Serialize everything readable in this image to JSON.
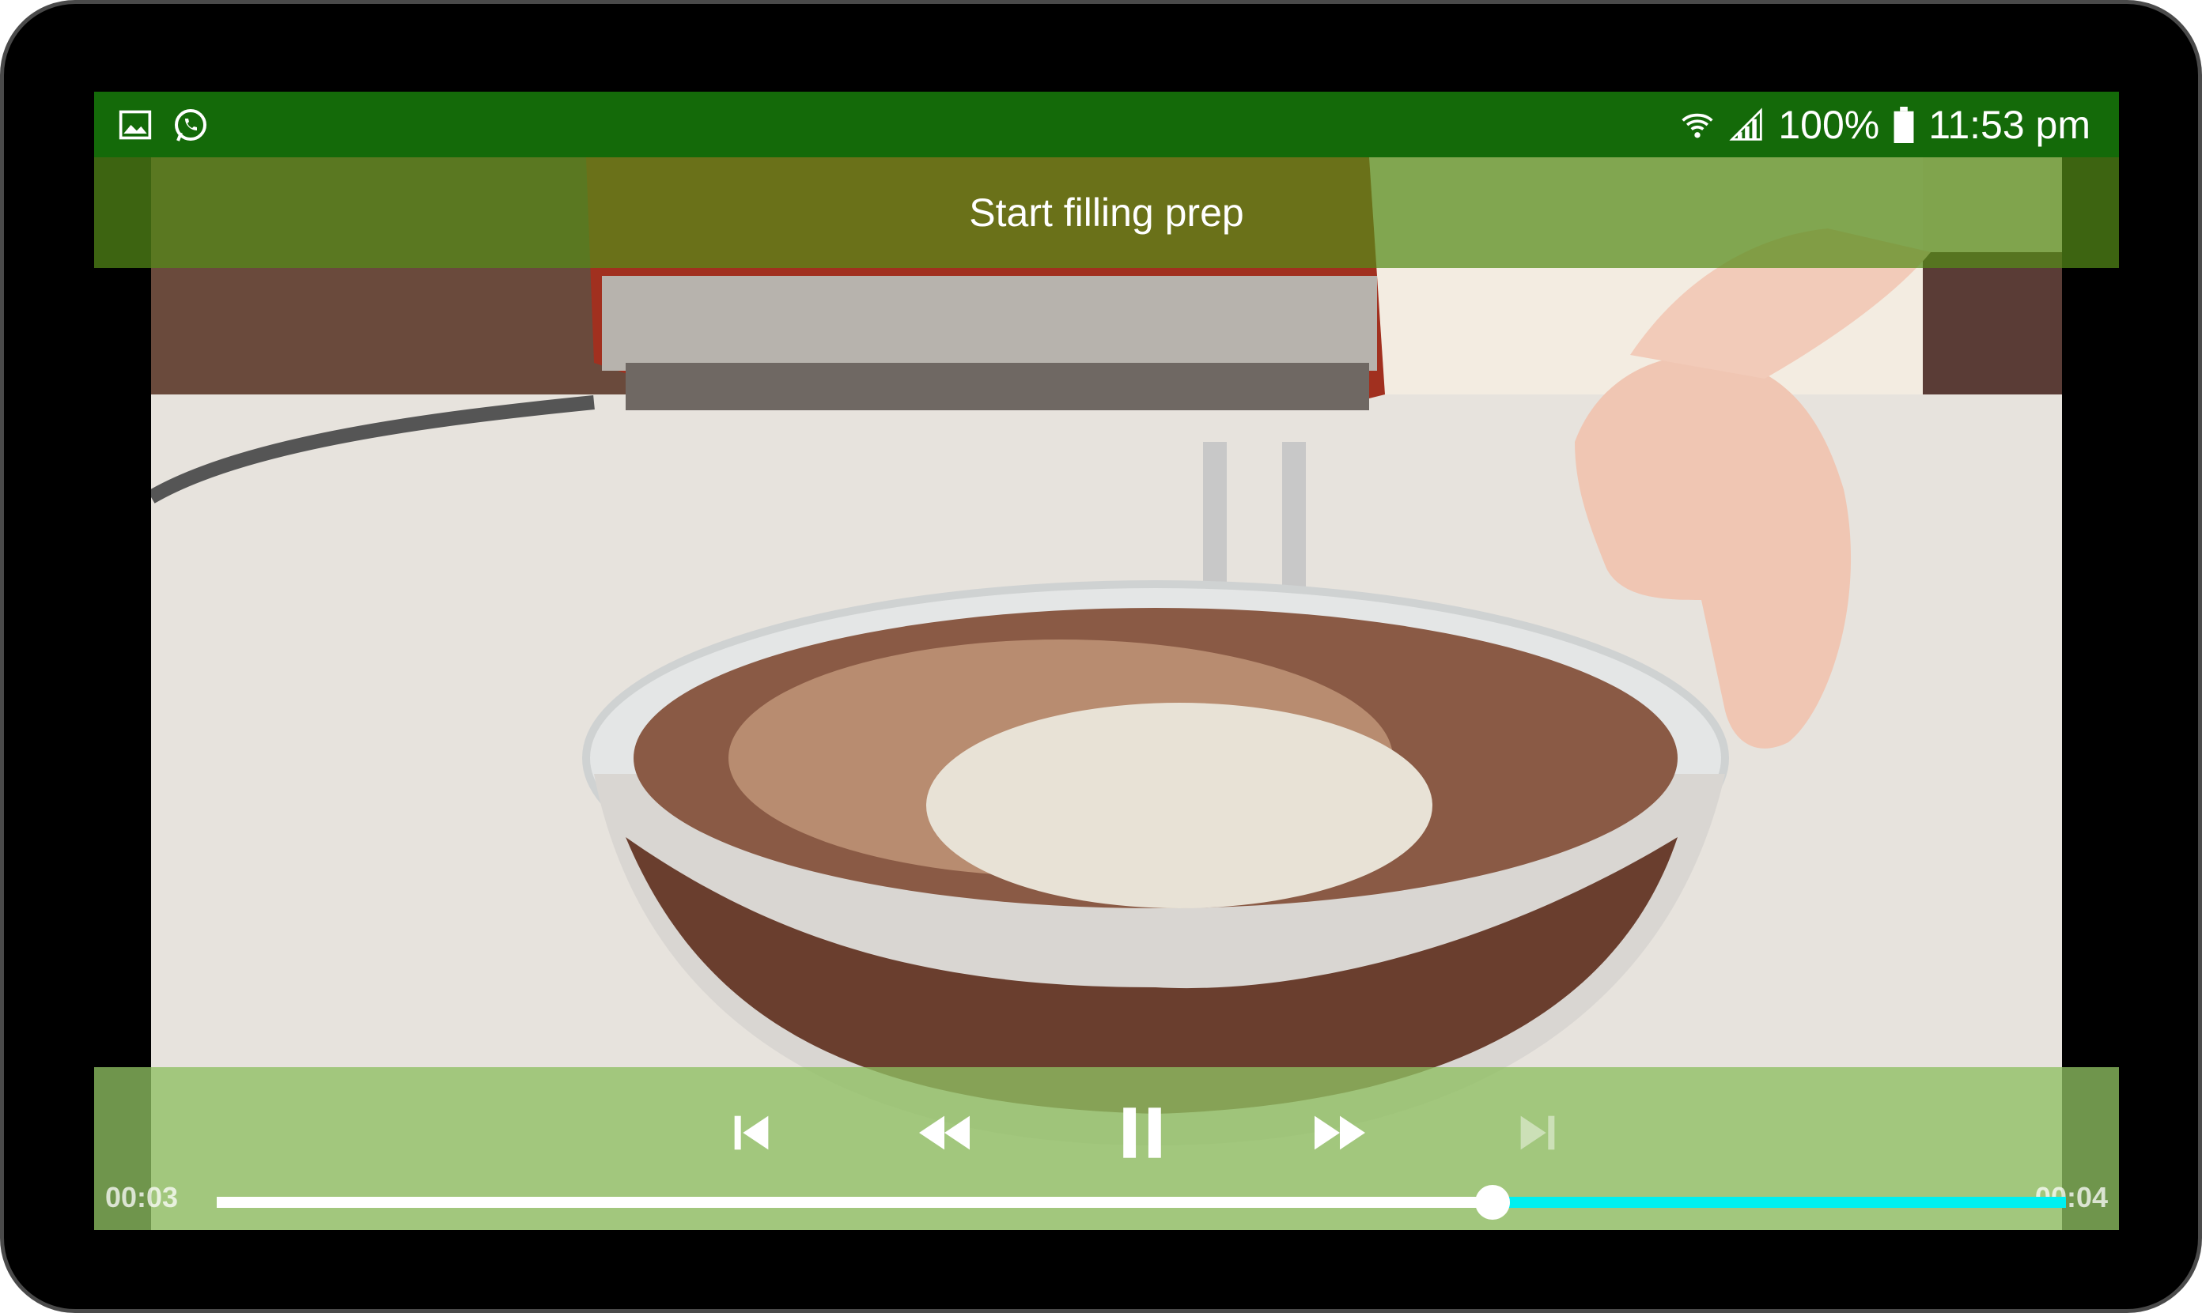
{
  "status_bar": {
    "left_icons": [
      "gallery-icon",
      "whatsapp-icon"
    ],
    "right_icons": [
      "wifi-icon",
      "signal-icon",
      "battery-icon"
    ],
    "battery": "100%",
    "time": "11:53 pm",
    "background_color": "#146a09"
  },
  "video": {
    "title": "Start filling prep"
  },
  "player": {
    "buttons": [
      "previous-icon",
      "rewind-icon",
      "pause-icon",
      "fast-forward-icon",
      "next-icon"
    ],
    "elapsed": "00:03",
    "duration": "00:04",
    "progress_fraction": 0.69,
    "played_color": "#ffffff",
    "remaining_color": "#00f0f0"
  }
}
